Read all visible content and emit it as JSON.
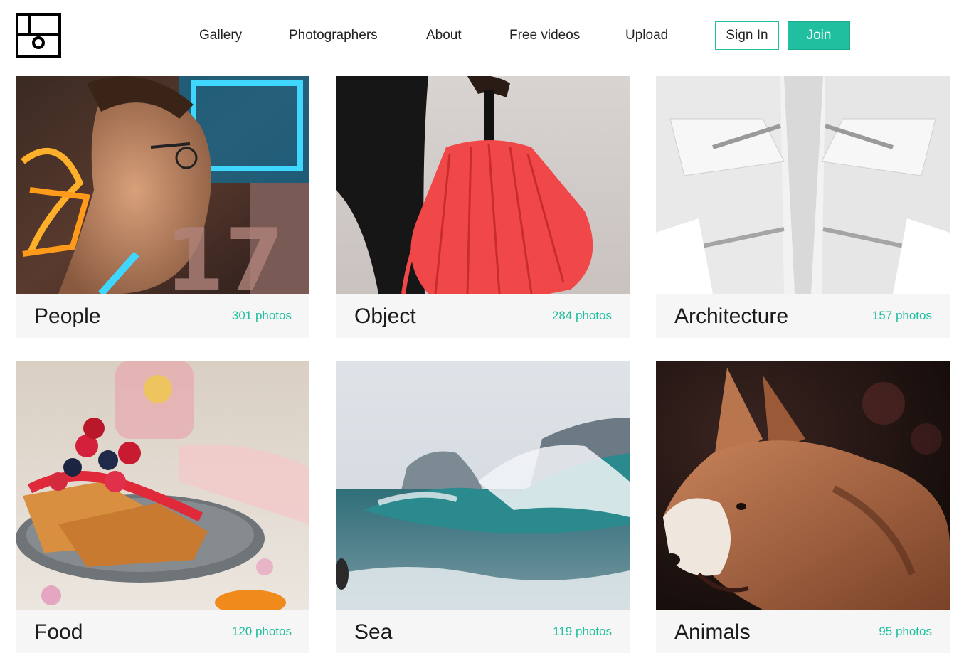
{
  "logo": {
    "icon": "frame-camera-logo-icon"
  },
  "nav": {
    "items": [
      {
        "label": "Gallery"
      },
      {
        "label": "Photographers"
      },
      {
        "label": "About"
      },
      {
        "label": "Free videos"
      },
      {
        "label": "Upload"
      }
    ],
    "sign_in": "Sign In",
    "join": "Join"
  },
  "colors": {
    "accent": "#1fbf9f",
    "caption_bg": "#f6f6f6",
    "text": "#1b1b1b"
  },
  "categories": [
    {
      "name": "People",
      "count": "301 photos",
      "image": "neon-portrait-photo"
    },
    {
      "name": "Object",
      "count": "284 photos",
      "image": "red-umbrella-photo"
    },
    {
      "name": "Architecture",
      "count": "157 photos",
      "image": "white-interior-photo"
    },
    {
      "name": "Food",
      "count": "120 photos",
      "image": "french-toast-berries-photo"
    },
    {
      "name": "Sea",
      "count": "119 photos",
      "image": "ocean-wave-photo"
    },
    {
      "name": "Animals",
      "count": "95 photos",
      "image": "dog-profile-photo"
    }
  ]
}
